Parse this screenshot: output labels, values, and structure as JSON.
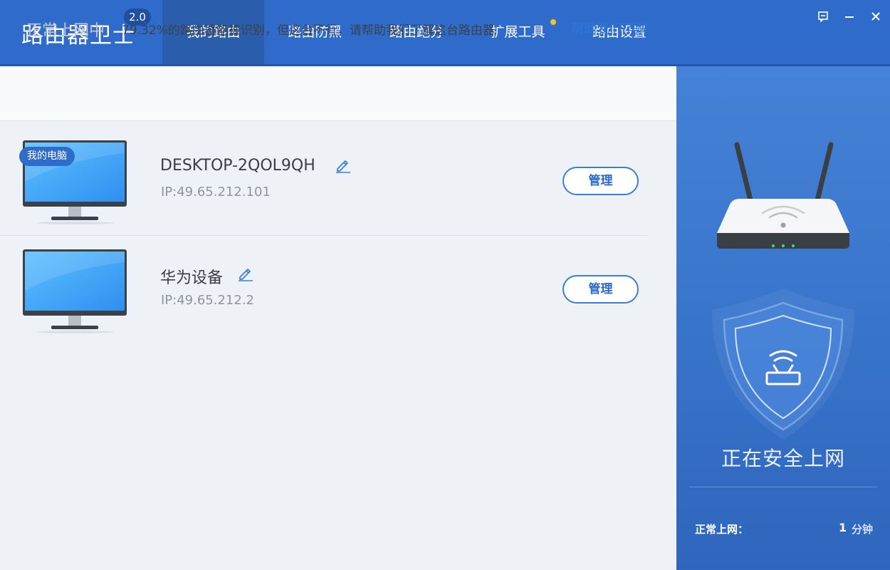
{
  "app": {
    "title": "路由器卫士",
    "version": "2.0"
  },
  "tabs": [
    {
      "label": "我的路由",
      "active": true
    },
    {
      "label": "路由防黑",
      "active": false
    },
    {
      "label": "路由跑分",
      "active": false
    },
    {
      "label": "扩展工具",
      "active": false,
      "notification_dot": true
    },
    {
      "label": "路由设置",
      "active": false
    }
  ],
  "window_controls": [
    "feedback-icon",
    "minimize-icon",
    "close-icon"
  ],
  "notice": {
    "status": "正常上网中",
    "message": "79.32%的路由器能被识别，但这台不行，请帮助我们了解这台路由器",
    "link": "帮助我们了解"
  },
  "devices": [
    {
      "badge": "我的电脑",
      "name": "DESKTOP-2QOL9QH",
      "ip": "IP:49.65.212.101",
      "button": "管理"
    },
    {
      "name": "华为设备",
      "ip": "IP:49.65.212.2",
      "button": "管理"
    }
  ],
  "side": {
    "status": "正在安全上网",
    "uptime_label": "正常上网：",
    "uptime_value": "1",
    "uptime_unit": "分钟"
  },
  "colors": {
    "primary": "#2f6bcb",
    "accent_link": "#2a78d6",
    "notification_dot": "#f5c518",
    "router_led": "#3fe05a"
  }
}
